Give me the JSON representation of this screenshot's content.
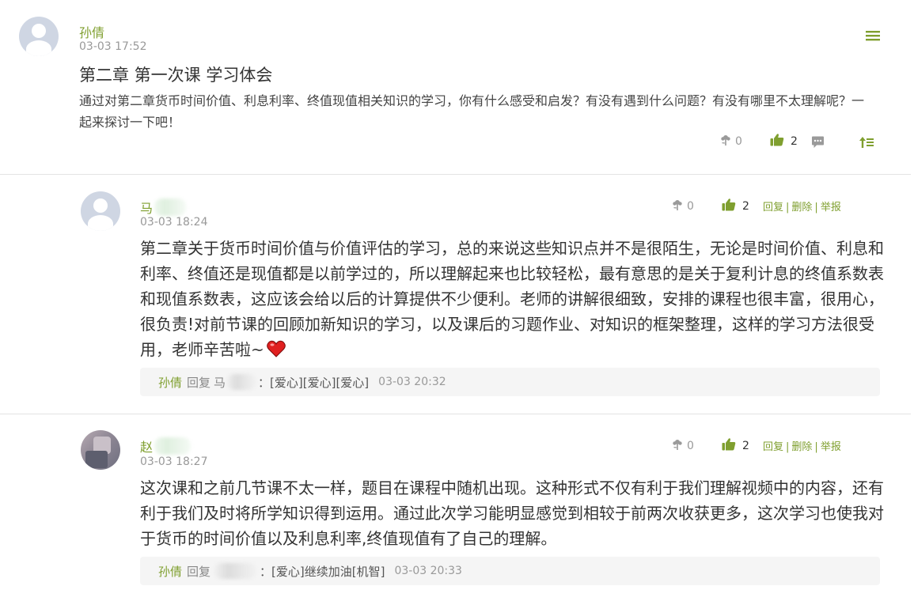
{
  "post": {
    "author": "孙倩",
    "time": "03-03 17:52",
    "title": "第二章 第一次课 学习体会",
    "content": "通过对第二章货币时间价值、利息利率、终值现值相关知识的学习，你有什么感受和启发？有没有遇到什么问题？有没有哪里不太理解呢？一起来探讨一下吧！",
    "flower_count": "0",
    "like_count": "2",
    "menu_icon": "hamburger-menu-icon"
  },
  "comments": [
    {
      "author": "马",
      "time": "03-03 18:24",
      "flower_count": "0",
      "like_count": "2",
      "reply_action": "回复",
      "delete_action": "删除",
      "report_action": "举报",
      "content": "第二章关于货币时间价值与价值评估的学习，总的来说这些知识点并不是很陌生，无论是时间价值、利息和利率、终值还是现值都是以前学过的，所以理解起来也比较轻松，最有意思的是关于复利计息的终值系数表和现值系数表，这应该会给以后的计算提供不少便利。老师的讲解很细致，安排的课程也很丰富，很用心，很负责!对前节课的回顾加新知识的学习，以及课后的习题作业、对知识的框架整理，这样的学习方法很受用，老师辛苦啦~",
      "reply": {
        "author": "孙倩",
        "label": "回复",
        "target": "马",
        "text": "：[爱心][爱心][爱心]",
        "time": "03-03 20:32"
      }
    },
    {
      "author": "赵",
      "time": "03-03 18:27",
      "flower_count": "0",
      "like_count": "2",
      "reply_action": "回复",
      "delete_action": "删除",
      "report_action": "举报",
      "content": "这次课和之前几节课不太一样，题目在课程中随机出现。这种形式不仅有利于我们理解视频中的内容，还有利于我们及时将所学知识得到运用。通过此次学习能明显感觉到相较于前两次收获更多，这次学习也使我对于货币的时间价值以及利息利率,终值现值有了自己的理解。",
      "reply": {
        "author": "孙倩",
        "label": "回复",
        "text": "：[爱心]继续加油[机智]",
        "time": "03-03 20:33"
      }
    }
  ],
  "colors": {
    "accent": "#7f9f2f",
    "heart": "#e02020"
  }
}
